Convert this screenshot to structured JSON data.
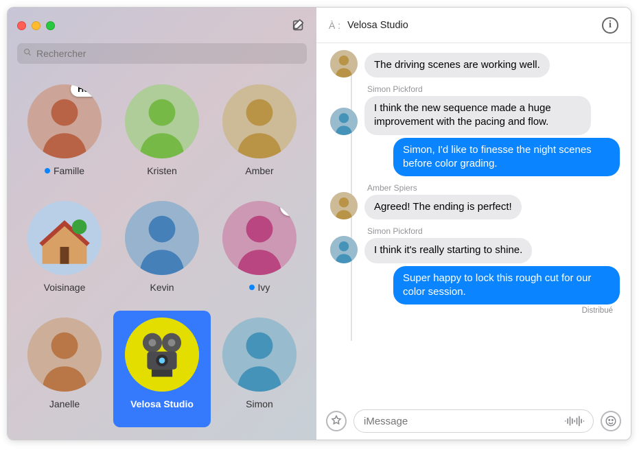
{
  "window": {
    "search_placeholder": "Rechercher"
  },
  "contacts": [
    {
      "name": "Famille",
      "unread": true,
      "bubble": "Home!",
      "avatar_hue": 15
    },
    {
      "name": "Kristen",
      "unread": false,
      "avatar_hue": 95
    },
    {
      "name": "Amber",
      "unread": false,
      "avatar_hue": 40
    },
    {
      "name": "Voisinage",
      "unread": false,
      "icon": "house",
      "avatar_bg": "#b9cfe8"
    },
    {
      "name": "Kevin",
      "unread": false,
      "avatar_hue": 210
    },
    {
      "name": "Ivy",
      "unread": true,
      "heart": true,
      "avatar_bg": "#cbb6ea",
      "avatar_hue": 330
    },
    {
      "name": "Janelle",
      "unread": false,
      "avatar_hue": 25
    },
    {
      "name": "Velosa Studio",
      "unread": false,
      "selected": true,
      "avatar_bg": "#e4de00",
      "icon": "projector"
    },
    {
      "name": "Simon",
      "unread": false,
      "avatar_hue": 200
    }
  ],
  "conversation": {
    "to_label": "À :",
    "to_name": "Velosa Studio",
    "delivered_label": "Distribué",
    "composer_placeholder": "iMessage",
    "messages": [
      {
        "dir": "in",
        "sender": "Amber Spiers",
        "show_sender": false,
        "avatar_hue": 40,
        "text": "The driving scenes are working well."
      },
      {
        "dir": "in",
        "sender": "Simon Pickford",
        "show_sender": true,
        "avatar_hue": 200,
        "text": "I think the new sequence made a huge improvement with the pacing and flow."
      },
      {
        "dir": "out",
        "text": "Simon, I'd like to finesse the night scenes before color grading."
      },
      {
        "dir": "in",
        "sender": "Amber Spiers",
        "show_sender": true,
        "avatar_hue": 40,
        "text": "Agreed! The ending is perfect!"
      },
      {
        "dir": "in",
        "sender": "Simon Pickford",
        "show_sender": true,
        "avatar_hue": 200,
        "text": "I think it's really starting to shine."
      },
      {
        "dir": "out",
        "text": "Super happy to lock this rough cut for our color session.",
        "delivered": true
      }
    ]
  }
}
